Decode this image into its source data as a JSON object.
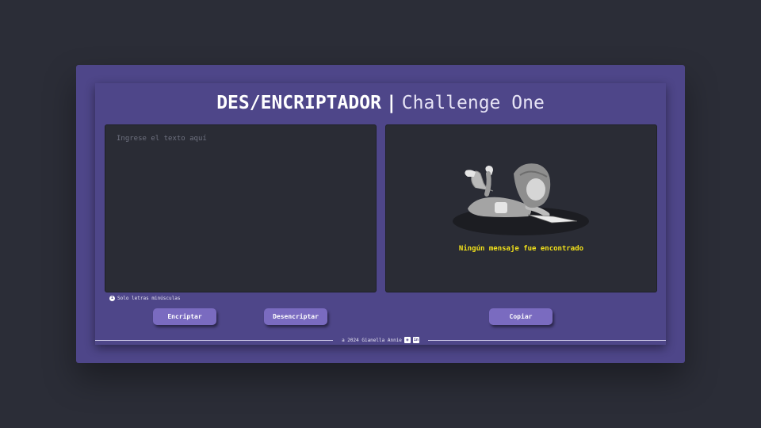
{
  "header": {
    "title_main": "DES/ENCRIPTADOR",
    "separator": "|",
    "title_sub": "Challenge One"
  },
  "input": {
    "placeholder": "Ingrese el texto aquí",
    "value": ""
  },
  "output": {
    "empty_message": "Ningún mensaje fue encontrado",
    "illustration_icon": "girl-reading-illustration"
  },
  "hint": {
    "text": "Solo letras minúsculas",
    "icon": "info-icon"
  },
  "buttons": {
    "encrypt": "Encriptar",
    "decrypt": "Desencriptar",
    "copy": "Copiar"
  },
  "footer": {
    "text": "a 2024 Gianella Annie",
    "icons": [
      "github-icon",
      "linkedin-icon"
    ]
  },
  "colors": {
    "background": "#2b2d37",
    "card": "#4e4689",
    "panel": "#2a2c35",
    "button": "#7a6bc0",
    "message": "#f3e21a"
  }
}
